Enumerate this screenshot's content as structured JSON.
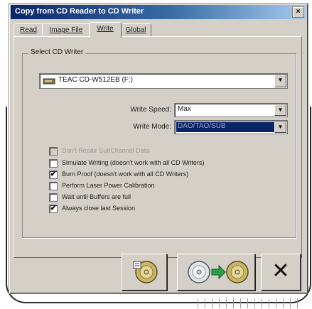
{
  "window": {
    "title": "Copy from CD Reader to CD Writer",
    "close_glyph": "×"
  },
  "tabs": [
    {
      "label": "Read",
      "active": false
    },
    {
      "label": "Image File",
      "active": false
    },
    {
      "label": "Write",
      "active": true
    },
    {
      "label": "Global",
      "active": false
    }
  ],
  "group": {
    "label": "Select CD Writer"
  },
  "writer_select": {
    "value": "TEAC CD-W512EB (F:)",
    "icon": "cd-drive-icon",
    "arrow": "▼"
  },
  "write_speed": {
    "label": "Write Speed:",
    "value": "Max",
    "arrow": "▼"
  },
  "write_mode": {
    "label": "Write Mode:",
    "value": "DAO/TAO/SUB",
    "arrow": "▼"
  },
  "options": [
    {
      "label": "Don't Repair SubChannel Data",
      "checked": false,
      "enabled": false
    },
    {
      "label": "Simulate Writing (doesn't work with all CD Writers)",
      "checked": false,
      "enabled": true
    },
    {
      "label": "Burn Proof (doesn't work with all CD Writers)",
      "checked": true,
      "enabled": true
    },
    {
      "label": "Perform Laser Power Calibration",
      "checked": false,
      "enabled": true
    },
    {
      "label": "Wait until Buffers are full",
      "checked": false,
      "enabled": true
    },
    {
      "label": "Always close last Session",
      "checked": true,
      "enabled": true
    }
  ],
  "buttons": {
    "save_profile_icon": "cd-profile-icon",
    "copy_icon": "cd-copy-icon",
    "cancel_icon": "close-icon",
    "cancel_glyph": "✕"
  },
  "check_glyph": "✔",
  "colors": {
    "titlebar_start": "#0a246a",
    "titlebar_end": "#a6caf0",
    "dialog_face": "#d4d0c8",
    "selection": "#0a246a"
  }
}
